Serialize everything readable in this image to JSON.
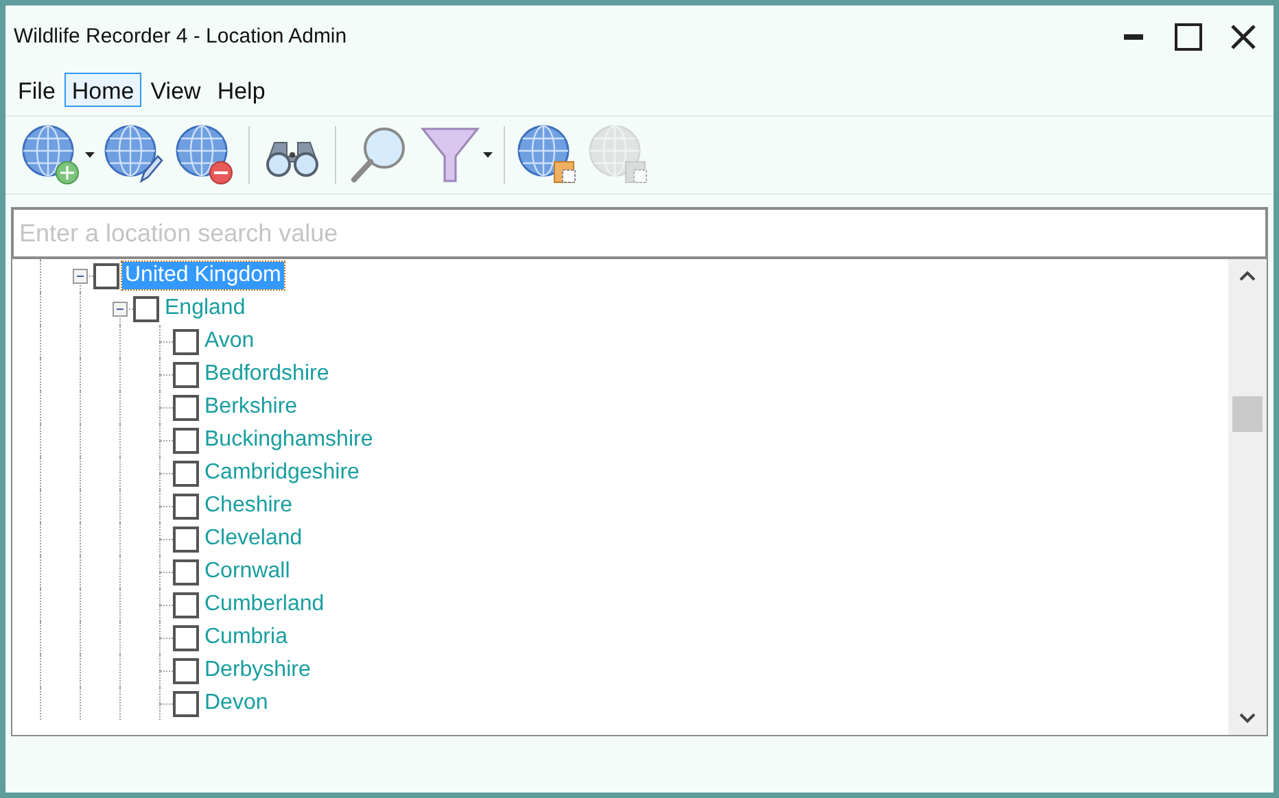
{
  "window": {
    "title": "Wildlife Recorder 4 - Location Admin"
  },
  "menu": [
    {
      "label": "File",
      "selected": false
    },
    {
      "label": "Home",
      "selected": true
    },
    {
      "label": "View",
      "selected": false
    },
    {
      "label": "Help",
      "selected": false
    }
  ],
  "toolbar": [
    {
      "kind": "globe-add",
      "dropdown": true,
      "disabled": false
    },
    {
      "kind": "globe-edit",
      "dropdown": false,
      "disabled": false
    },
    {
      "kind": "globe-remove",
      "dropdown": false,
      "disabled": false
    },
    {
      "kind": "separator"
    },
    {
      "kind": "binoculars",
      "dropdown": false,
      "disabled": false
    },
    {
      "kind": "separator"
    },
    {
      "kind": "magnifier",
      "dropdown": false,
      "disabled": false
    },
    {
      "kind": "funnel",
      "dropdown": true,
      "disabled": false
    },
    {
      "kind": "separator"
    },
    {
      "kind": "globe-paste",
      "dropdown": false,
      "disabled": false
    },
    {
      "kind": "globe-paste",
      "dropdown": false,
      "disabled": true
    }
  ],
  "search": {
    "placeholder": "Enter a location search value"
  },
  "tree": [
    {
      "label": "United Kingdom",
      "selected": true,
      "checked": false,
      "expanded": true,
      "children": [
        {
          "label": "England",
          "selected": false,
          "checked": false,
          "expanded": true,
          "children": [
            {
              "label": "Avon",
              "selected": false,
              "checked": false
            },
            {
              "label": "Bedfordshire",
              "selected": false,
              "checked": false
            },
            {
              "label": "Berkshire",
              "selected": false,
              "checked": false
            },
            {
              "label": "Buckinghamshire",
              "selected": false,
              "checked": false
            },
            {
              "label": "Cambridgeshire",
              "selected": false,
              "checked": false
            },
            {
              "label": "Cheshire",
              "selected": false,
              "checked": false
            },
            {
              "label": "Cleveland",
              "selected": false,
              "checked": false
            },
            {
              "label": "Cornwall",
              "selected": false,
              "checked": false
            },
            {
              "label": "Cumberland",
              "selected": false,
              "checked": false
            },
            {
              "label": "Cumbria",
              "selected": false,
              "checked": false
            },
            {
              "label": "Derbyshire",
              "selected": false,
              "checked": false
            },
            {
              "label": "Devon",
              "selected": false,
              "checked": false
            }
          ]
        }
      ]
    }
  ]
}
